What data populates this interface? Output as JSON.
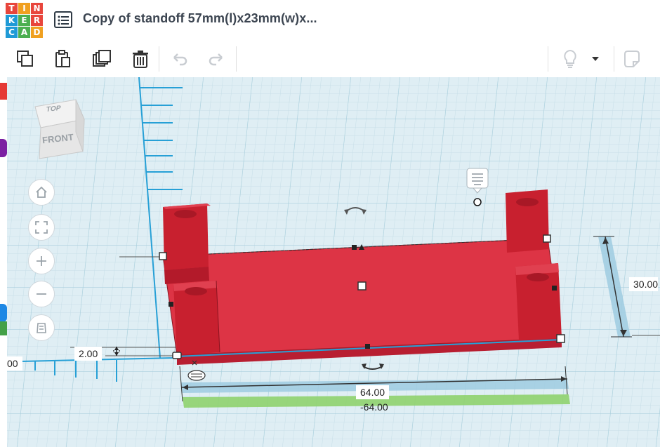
{
  "header": {
    "logo_letters": [
      "T",
      "I",
      "N",
      "K",
      "E",
      "R",
      "C",
      "A",
      "D"
    ],
    "doc_title": "Copy of standoff 57mm(l)x23mm(w)x..."
  },
  "toolbar": {
    "icons": [
      "copy-icon",
      "paste-icon",
      "duplicate-icon",
      "delete-icon",
      "undo-icon",
      "redo-icon",
      "lightbulb-icon",
      "dropdown-icon",
      "note-icon"
    ]
  },
  "viewcube": {
    "top": "TOP",
    "front": "FRONT"
  },
  "dimensions": {
    "length": "64.00",
    "length_neg": "-64.00",
    "height": "2.00",
    "width": "30.00",
    "left_partial": "00"
  },
  "colors": {
    "shape_fill": "#d1263a",
    "shape_top": "#dd3445",
    "workplane": "#dfeef4",
    "grid_minor": "#c7dfe8",
    "grid_major": "#a9cfdd",
    "ruler": "#27a0d6",
    "dim_green": "#8fd26e",
    "dim_blue": "#9fcbe0"
  }
}
